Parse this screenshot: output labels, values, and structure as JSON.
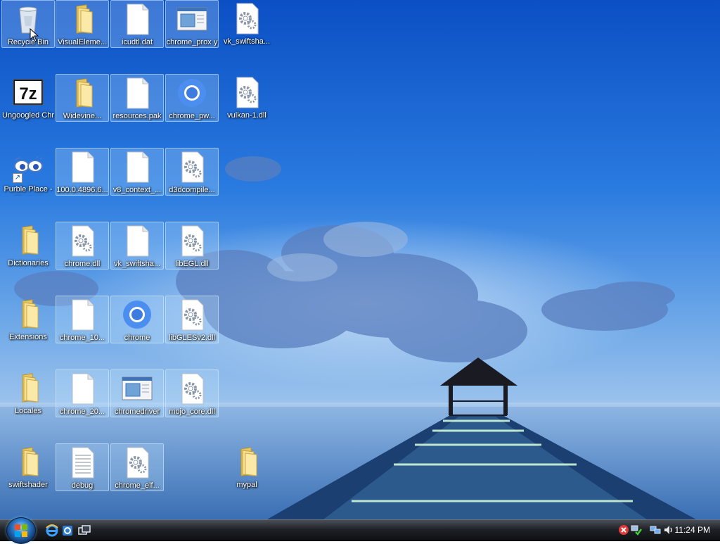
{
  "desktop": {
    "icons": [
      {
        "id": "recycle",
        "label": "Recycle Bin",
        "type": "recycle",
        "selected": true
      },
      {
        "id": "visualelements",
        "label": "VisualEleme...",
        "type": "folder",
        "selected": true
      },
      {
        "id": "icudtl",
        "label": "icudtl.dat",
        "type": "file",
        "selected": true
      },
      {
        "id": "chrome_proxy",
        "label": "chrome_prox y",
        "type": "exe",
        "selected": true
      },
      {
        "id": "vk_swiftshader1",
        "label": "vk_swiftsha...",
        "type": "dll",
        "selected": false
      },
      {
        "id": "ungoogled",
        "label": "Ungoogled Chromium...",
        "type": "7z",
        "selected": false
      },
      {
        "id": "widevine",
        "label": "Widevine...",
        "type": "folder",
        "selected": true
      },
      {
        "id": "resources",
        "label": "resources.pak",
        "type": "file",
        "selected": true
      },
      {
        "id": "chrome_pwa",
        "label": "chrome_pw...",
        "type": "chrome",
        "selected": true
      },
      {
        "id": "vulkan",
        "label": "vulkan-1.dll",
        "type": "dll",
        "selected": false
      },
      {
        "id": "purble",
        "label": "Purble Place - Shortcut",
        "type": "purble",
        "selected": false
      },
      {
        "id": "v100",
        "label": "100.0.4896.6...",
        "type": "file",
        "selected": true
      },
      {
        "id": "v8_context",
        "label": "v8_context_...",
        "type": "file",
        "selected": true
      },
      {
        "id": "d3dcompiler",
        "label": "d3dcompile...",
        "type": "dll",
        "selected": true
      },
      {
        "id": "dictionaries",
        "label": "Dictionaries",
        "type": "folder",
        "selected": false
      },
      {
        "id": "chrome_dll",
        "label": "chrome.dll",
        "type": "dll",
        "selected": true
      },
      {
        "id": "vk_swiftshader2",
        "label": "vk_swiftsha...",
        "type": "file",
        "selected": true
      },
      {
        "id": "libegl",
        "label": "libEGL.dll",
        "type": "dll",
        "selected": true
      },
      {
        "id": "extensions",
        "label": "Extensions",
        "type": "folder",
        "selected": false
      },
      {
        "id": "chrome_10",
        "label": "chrome_10...",
        "type": "file",
        "selected": true
      },
      {
        "id": "chrome",
        "label": "chrome",
        "type": "chrome",
        "selected": true
      },
      {
        "id": "libglesv2",
        "label": "libGLESv2.dll",
        "type": "dll",
        "selected": true
      },
      {
        "id": "locales",
        "label": "Locales",
        "type": "folder",
        "selected": false
      },
      {
        "id": "chrome_20",
        "label": "chrome_20...",
        "type": "file",
        "selected": true
      },
      {
        "id": "chromedriver",
        "label": "chromedriver",
        "type": "exe",
        "selected": true
      },
      {
        "id": "mojo_core",
        "label": "mojo_core.dll",
        "type": "dll",
        "selected": true
      },
      {
        "id": "swiftshader",
        "label": "swiftshader",
        "type": "folder",
        "selected": false
      },
      {
        "id": "debug",
        "label": "debug",
        "type": "text",
        "selected": true
      },
      {
        "id": "chrome_elf",
        "label": "chrome_elf...",
        "type": "dll",
        "selected": true
      },
      {
        "id": "mypal",
        "label": "mypal",
        "type": "folder",
        "selected": false
      }
    ]
  },
  "taskbar": {
    "clock": "11:24 PM",
    "quick_launch": [
      "internet-explorer-icon",
      "ie-alt-icon",
      "switch-windows-icon"
    ],
    "tray_icons": [
      "security-alert-icon",
      "network-status-icon",
      "display-icon",
      "volume-icon"
    ]
  }
}
